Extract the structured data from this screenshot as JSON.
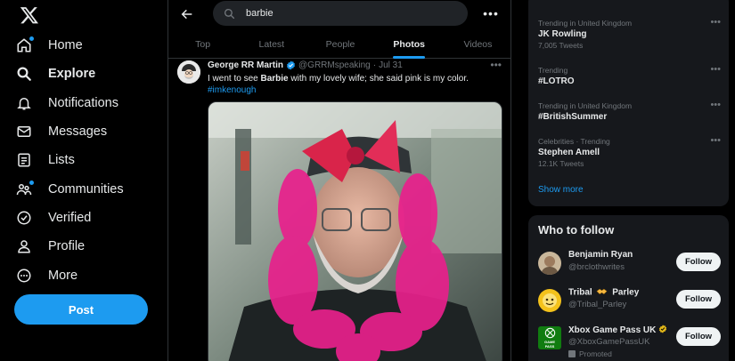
{
  "nav": {
    "items": [
      {
        "label": "Home",
        "icon": "home-icon",
        "has_dot": true
      },
      {
        "label": "Explore",
        "icon": "search-icon",
        "active": true
      },
      {
        "label": "Notifications",
        "icon": "bell-icon"
      },
      {
        "label": "Messages",
        "icon": "envelope-icon"
      },
      {
        "label": "Lists",
        "icon": "list-icon"
      },
      {
        "label": "Communities",
        "icon": "communities-icon",
        "has_dot": true
      },
      {
        "label": "Verified",
        "icon": "verified-icon"
      },
      {
        "label": "Profile",
        "icon": "person-icon"
      },
      {
        "label": "More",
        "icon": "more-circle-icon"
      }
    ],
    "post_label": "Post"
  },
  "search": {
    "value": "barbie",
    "more": "•••"
  },
  "tabs": [
    {
      "label": "Top"
    },
    {
      "label": "Latest"
    },
    {
      "label": "People"
    },
    {
      "label": "Photos",
      "active": true
    },
    {
      "label": "Videos"
    }
  ],
  "tweet": {
    "name": "George RR Martin",
    "handle": "@GRRMspeaking",
    "sep": "·",
    "date": "Jul 31",
    "text_before": "I went to see ",
    "text_bold": "Barbie",
    "text_after": " with my lovely wife; she said pink is my color.",
    "hashtag": "#imkenough",
    "more": "•••"
  },
  "trends": [
    {
      "context": "Trending in United Kingdom",
      "name": "JK Rowling",
      "count": "7,005 Tweets"
    },
    {
      "context": "Trending",
      "name": "#LOTRO",
      "count": ""
    },
    {
      "context": "Trending in United Kingdom",
      "name": "#BritishSummer",
      "count": ""
    },
    {
      "context": "Celebrities · Trending",
      "name": "Stephen Amell",
      "count": "12.1K Tweets"
    }
  ],
  "trend_more": "•••",
  "show_more": "Show more",
  "who_to_follow": {
    "title": "Who to follow",
    "accounts": [
      {
        "name": "Benjamin Ryan",
        "handle": "@brclothwrites",
        "button": "Follow"
      },
      {
        "name": "Tribal",
        "name_suffix": "Parley",
        "handle": "@Tribal_Parley",
        "button": "Follow"
      },
      {
        "name": "Xbox Game Pass UK",
        "handle": "@XboxGamePassUK",
        "promoted": "Promoted",
        "button": "Follow",
        "pic_text": "GAME PASS"
      }
    ]
  },
  "colors": {
    "accent": "#1d9bf0",
    "background": "#000000",
    "panel": "#16181c",
    "muted": "#71767b",
    "boa_pink": "#e8208c"
  }
}
